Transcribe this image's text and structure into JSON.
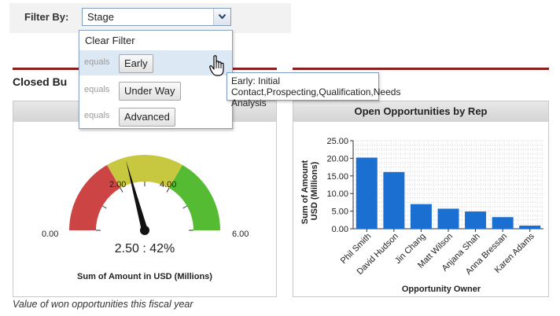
{
  "filter": {
    "label": "Filter By:",
    "selected": "Stage",
    "clear_label": "Clear Filter",
    "options": [
      {
        "op": "equals",
        "value": "Early"
      },
      {
        "op": "equals",
        "value": "Under Way"
      },
      {
        "op": "equals",
        "value": "Advanced"
      }
    ],
    "tooltip": "Early: Initial Contact,Prospecting,Qualification,Needs Analysis"
  },
  "left_panel": {
    "section_title": "Closed Bu",
    "footnote": "Value of won opportunities this fiscal year",
    "gauge": {
      "min": 0,
      "max": 6,
      "value": 2.5,
      "value_label": "2.50 : 42%",
      "title": "Sum of Amount in USD (Millions)",
      "bands": [
        {
          "from": 0,
          "to": 2,
          "color": "#cc4444"
        },
        {
          "from": 2,
          "to": 4,
          "color": "#c8c840"
        },
        {
          "from": 4,
          "to": 6,
          "color": "#55bb33"
        }
      ],
      "labels": [
        "0.00",
        "2.00",
        "4.00",
        "6.00"
      ]
    }
  },
  "chart_data": {
    "type": "bar",
    "title": "Open Opportunities by Rep",
    "xlabel": "Opportunity Owner",
    "ylabel": "Sum of Amount in USD (Millions)",
    "ylim": [
      0,
      25
    ],
    "yticks": [
      "0.00",
      "5.00",
      "10.00",
      "15.00",
      "20.00",
      "25.00"
    ],
    "categories": [
      "Phil Smith",
      "David Hudson",
      "Jin Chang",
      "Matt Wilson",
      "Anjana Shah",
      "Anna Bressan",
      "Karen Adams"
    ],
    "values": [
      20.2,
      16.1,
      7.0,
      5.7,
      4.9,
      3.3,
      0.9
    ],
    "bar_color": "#1a6fd0",
    "grid": true
  }
}
